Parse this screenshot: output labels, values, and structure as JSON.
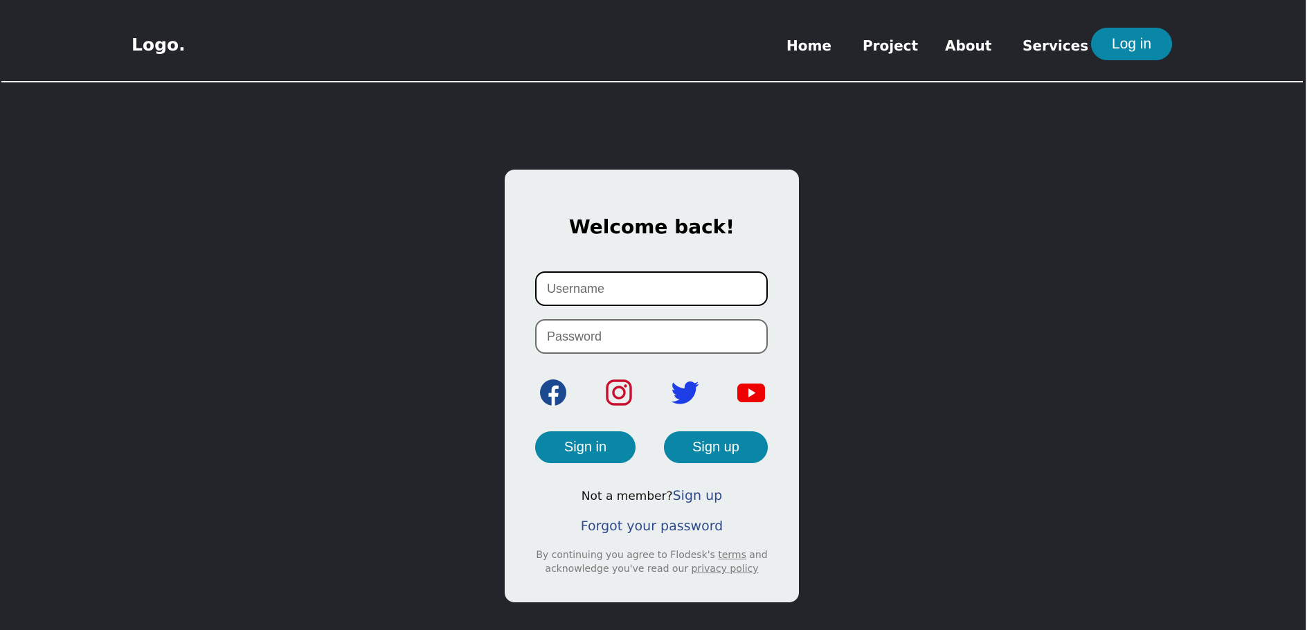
{
  "header": {
    "logo": "Logo.",
    "nav": [
      "Home",
      "Project",
      "About",
      "Services"
    ],
    "login_label": "Log in"
  },
  "card": {
    "title": "Welcome back!",
    "username_placeholder": "Username",
    "password_placeholder": "Password",
    "social_icons": [
      "facebook-icon",
      "instagram-icon",
      "twitter-icon",
      "youtube-icon"
    ],
    "signin_label": "Sign in",
    "signup_label": "Sign up",
    "member_text": "Not a member?",
    "member_link": "Sign up",
    "forgot_label": "Forgot your password",
    "legal_prefix": "By continuing you agree to Flodesk's ",
    "legal_terms": "terms",
    "legal_middle": " and acknowledge you've read our ",
    "legal_privacy": "privacy policy"
  },
  "colors": {
    "background": "#23252b",
    "card": "#ebeff0",
    "accent": "#0a87a6",
    "link": "#2e4a8c",
    "facebook": "#1b4a93",
    "instagram": "#c8102e",
    "twitter": "#1d3de6",
    "youtube": "#ee0000"
  }
}
